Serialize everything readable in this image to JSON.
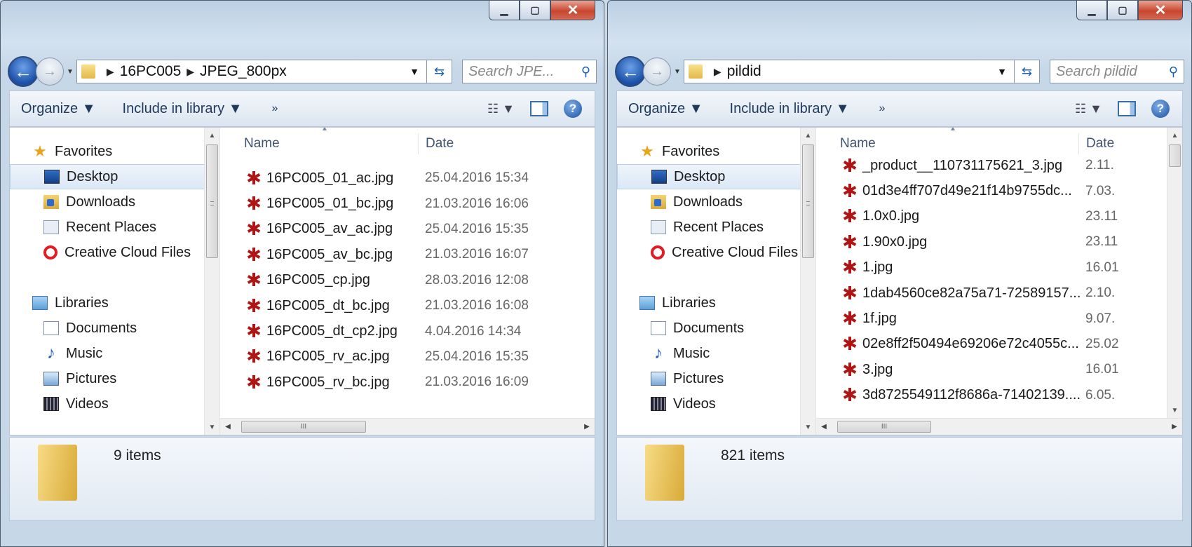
{
  "left": {
    "path": [
      "16PC005",
      "JPEG_800px"
    ],
    "search_placeholder": "Search JPE...",
    "toolbar": {
      "organize": "Organize ▼",
      "include": "Include in library ▼",
      "more": "»"
    },
    "nav": [
      {
        "label": "Favorites",
        "icon": "star-icon"
      },
      {
        "label": "Desktop",
        "icon": "desktop-icon"
      },
      {
        "label": "Downloads",
        "icon": "downloads-icon"
      },
      {
        "label": "Recent Places",
        "icon": "recent-places-icon"
      },
      {
        "label": "Creative Cloud Files",
        "icon": "creative-cloud-icon"
      },
      {
        "label": "Libraries",
        "icon": "libraries-icon"
      },
      {
        "label": "Documents",
        "icon": "documents-icon"
      },
      {
        "label": "Music",
        "icon": "music-icon"
      },
      {
        "label": "Pictures",
        "icon": "pictures-icon"
      },
      {
        "label": "Videos",
        "icon": "videos-icon"
      }
    ],
    "columns": {
      "name": "Name",
      "date": "Date"
    },
    "files": [
      {
        "name": "16PC005_01_ac.jpg",
        "date": "25.04.2016 15:34"
      },
      {
        "name": "16PC005_01_bc.jpg",
        "date": "21.03.2016 16:06"
      },
      {
        "name": "16PC005_av_ac.jpg",
        "date": "25.04.2016 15:35"
      },
      {
        "name": "16PC005_av_bc.jpg",
        "date": "21.03.2016 16:07"
      },
      {
        "name": "16PC005_cp.jpg",
        "date": "28.03.2016 12:08"
      },
      {
        "name": "16PC005_dt_bc.jpg",
        "date": "21.03.2016 16:08"
      },
      {
        "name": "16PC005_dt_cp2.jpg",
        "date": "4.04.2016 14:34"
      },
      {
        "name": "16PC005_rv_ac.jpg",
        "date": "25.04.2016 15:35"
      },
      {
        "name": "16PC005_rv_bc.jpg",
        "date": "21.03.2016 16:09"
      }
    ],
    "status": "9 items",
    "scroll_thumb": "III"
  },
  "right": {
    "path": [
      "pildid"
    ],
    "search_placeholder": "Search pildid",
    "toolbar": {
      "organize": "Organize ▼",
      "include": "Include in library ▼",
      "more": "»"
    },
    "nav": [
      {
        "label": "Favorites",
        "icon": "star-icon"
      },
      {
        "label": "Desktop",
        "icon": "desktop-icon"
      },
      {
        "label": "Downloads",
        "icon": "downloads-icon"
      },
      {
        "label": "Recent Places",
        "icon": "recent-places-icon"
      },
      {
        "label": "Creative Cloud Files",
        "icon": "creative-cloud-icon"
      },
      {
        "label": "Libraries",
        "icon": "libraries-icon"
      },
      {
        "label": "Documents",
        "icon": "documents-icon"
      },
      {
        "label": "Music",
        "icon": "music-icon"
      },
      {
        "label": "Pictures",
        "icon": "pictures-icon"
      },
      {
        "label": "Videos",
        "icon": "videos-icon"
      }
    ],
    "columns": {
      "name": "Name",
      "date": "Date"
    },
    "files": [
      {
        "name": "_product__110731175621_3.jpg",
        "date": "2.11."
      },
      {
        "name": "01d3e4ff707d49e21f14b9755dc...",
        "date": "7.03."
      },
      {
        "name": "1.0x0.jpg",
        "date": "23.11"
      },
      {
        "name": "1.90x0.jpg",
        "date": "23.11"
      },
      {
        "name": "1.jpg",
        "date": "16.01"
      },
      {
        "name": "1dab4560ce82a75a71-72589157...",
        "date": "2.10."
      },
      {
        "name": "1f.jpg",
        "date": "9.07."
      },
      {
        "name": "02e8ff2f50494e69206e72c4055c...",
        "date": "25.02"
      },
      {
        "name": "3.jpg",
        "date": "16.01"
      },
      {
        "name": "3d8725549112f8686a-71402139....",
        "date": "6.05."
      }
    ],
    "status": "821 items",
    "scroll_thumb": "III"
  }
}
